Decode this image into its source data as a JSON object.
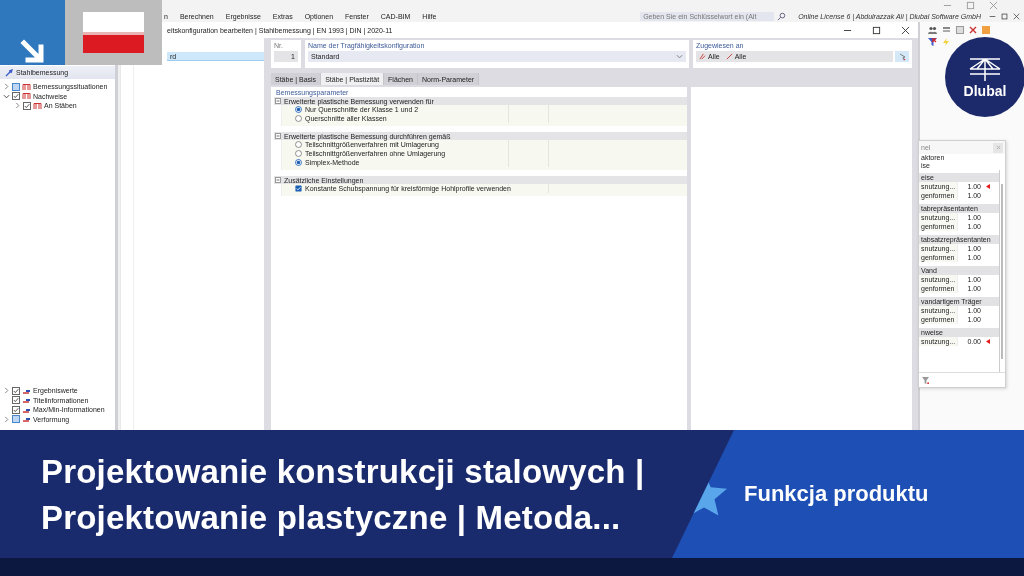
{
  "app": {
    "menu": [
      "n",
      "Berechnen",
      "Ergebnisse",
      "Extras",
      "Optionen",
      "Fenster",
      "CAD-BIM",
      "Hilfe"
    ],
    "search": {
      "placeholder": "Geben Sie ein Schlüsselwort ein (Alt"
    },
    "license": "Online License 6 | Abdulrazzak Ali | Dlubal Software GmbH"
  },
  "navigator": {
    "title": "Stahlbemessung",
    "tree": [
      {
        "label": "Bemessungssituationen",
        "checked": false,
        "expanded": false
      },
      {
        "label": "Nachweise",
        "checked": true,
        "expanded": true,
        "children": [
          {
            "label": "An Stäben",
            "checked": true,
            "expanded": false
          }
        ]
      }
    ],
    "display": [
      {
        "label": "Ergebniswerte",
        "checked": true,
        "expanded": false
      },
      {
        "label": "Titelinformationen",
        "checked": true
      },
      {
        "label": "Max/Min-Informationen",
        "checked": true
      },
      {
        "label": "Verformung",
        "checked": false,
        "expanded": false
      }
    ]
  },
  "dialog": {
    "title": "eitskonfiguration bearbeiten | Stahlbemessung | EN 1993 | DIN | 2020-11",
    "list": [
      {
        "label": "rd",
        "selected": true
      }
    ],
    "number": {
      "label": "Nr.",
      "value": "1"
    },
    "name": {
      "label": "Name der Tragfähigkeitskonfiguration",
      "value": "Standard"
    },
    "assigned": {
      "label": "Zugewiesen an",
      "items": [
        "Alle",
        "Alle"
      ]
    },
    "tabs": [
      {
        "label": "Stäbe | Basis",
        "selected": false
      },
      {
        "label": "Stäbe | Plastizität",
        "selected": true
      },
      {
        "label": "Flächen",
        "selected": false
      },
      {
        "label": "Norm-Parameter",
        "selected": false
      }
    ],
    "section": "Bemessungsparameter",
    "groups": [
      {
        "title": "Erweiterte plastische Bemessung verwenden für",
        "options": [
          {
            "kind": "radio",
            "label": "Nur Querschnitte der Klasse 1 und 2",
            "selected": true
          },
          {
            "kind": "radio",
            "label": "Querschnitte aller Klassen",
            "selected": false
          }
        ]
      },
      {
        "title": "Erweiterte plastische Bemessung durchführen gemäß",
        "options": [
          {
            "kind": "radio",
            "label": "Teilschnittgrößenverfahren mit Umlagerung",
            "selected": false
          },
          {
            "kind": "radio",
            "label": "Teilschnittgrößenverfahren ohne Umlagerung",
            "selected": false
          },
          {
            "kind": "radio",
            "label": "Simplex-Methode",
            "selected": true
          }
        ]
      },
      {
        "title": "Zusätzliche Einstellungen",
        "options": [
          {
            "kind": "checkbox",
            "label": "Konstante Schubspannung für kreisförmige Hohlprofile verwenden",
            "checked": true
          }
        ]
      }
    ]
  },
  "panel": {
    "title": "nel",
    "lines": [
      "aktoren",
      "ise"
    ],
    "groups": [
      {
        "title": "eise",
        "rows": [
          {
            "label": "snutzung...",
            "value": "1.00",
            "flag": true
          },
          {
            "label": "genformen",
            "value": "1.00",
            "flag": false
          }
        ]
      },
      {
        "title": "tabrepräsentanten",
        "rows": [
          {
            "label": "snutzung...",
            "value": "1.00",
            "flag": false
          },
          {
            "label": "genformen",
            "value": "1.00",
            "flag": false
          }
        ]
      },
      {
        "title": "tabsatzrepräsentanten",
        "rows": [
          {
            "label": "snutzung...",
            "value": "1.00",
            "flag": false
          },
          {
            "label": "genformen",
            "value": "1.00",
            "flag": false
          }
        ]
      },
      {
        "title": "Vand",
        "rows": [
          {
            "label": "snutzung...",
            "value": "1.00",
            "flag": false
          },
          {
            "label": "genformen",
            "value": "1.00",
            "flag": false
          }
        ]
      },
      {
        "title": "vandartigem Träger",
        "rows": [
          {
            "label": "snutzung...",
            "value": "1.00",
            "flag": false
          },
          {
            "label": "genformen",
            "value": "1.00",
            "flag": false
          }
        ]
      },
      {
        "title": "nweise",
        "rows": [
          {
            "label": "snutzung...",
            "value": "0.00",
            "flag": true
          }
        ]
      }
    ]
  },
  "logo": {
    "text": "Dlubal"
  },
  "banner": {
    "title_lines": [
      "Projektowanie konstrukcji stalowych |",
      "Projektowanie plastyczne | Metoda..."
    ],
    "tag": "Funkcja produktu"
  }
}
